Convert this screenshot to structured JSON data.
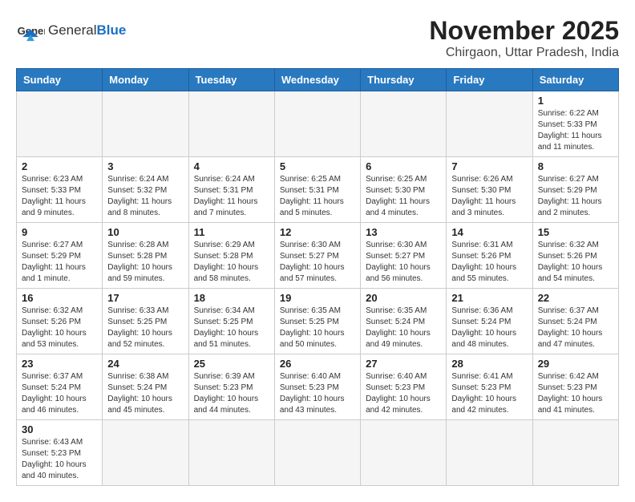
{
  "header": {
    "logo_general": "General",
    "logo_blue": "Blue",
    "month_title": "November 2025",
    "location": "Chirgaon, Uttar Pradesh, India"
  },
  "weekdays": [
    "Sunday",
    "Monday",
    "Tuesday",
    "Wednesday",
    "Thursday",
    "Friday",
    "Saturday"
  ],
  "weeks": [
    [
      {
        "day": "",
        "info": ""
      },
      {
        "day": "",
        "info": ""
      },
      {
        "day": "",
        "info": ""
      },
      {
        "day": "",
        "info": ""
      },
      {
        "day": "",
        "info": ""
      },
      {
        "day": "",
        "info": ""
      },
      {
        "day": "1",
        "info": "Sunrise: 6:22 AM\nSunset: 5:33 PM\nDaylight: 11 hours and 11 minutes."
      }
    ],
    [
      {
        "day": "2",
        "info": "Sunrise: 6:23 AM\nSunset: 5:33 PM\nDaylight: 11 hours and 9 minutes."
      },
      {
        "day": "3",
        "info": "Sunrise: 6:24 AM\nSunset: 5:32 PM\nDaylight: 11 hours and 8 minutes."
      },
      {
        "day": "4",
        "info": "Sunrise: 6:24 AM\nSunset: 5:31 PM\nDaylight: 11 hours and 7 minutes."
      },
      {
        "day": "5",
        "info": "Sunrise: 6:25 AM\nSunset: 5:31 PM\nDaylight: 11 hours and 5 minutes."
      },
      {
        "day": "6",
        "info": "Sunrise: 6:25 AM\nSunset: 5:30 PM\nDaylight: 11 hours and 4 minutes."
      },
      {
        "day": "7",
        "info": "Sunrise: 6:26 AM\nSunset: 5:30 PM\nDaylight: 11 hours and 3 minutes."
      },
      {
        "day": "8",
        "info": "Sunrise: 6:27 AM\nSunset: 5:29 PM\nDaylight: 11 hours and 2 minutes."
      }
    ],
    [
      {
        "day": "9",
        "info": "Sunrise: 6:27 AM\nSunset: 5:29 PM\nDaylight: 11 hours and 1 minute."
      },
      {
        "day": "10",
        "info": "Sunrise: 6:28 AM\nSunset: 5:28 PM\nDaylight: 10 hours and 59 minutes."
      },
      {
        "day": "11",
        "info": "Sunrise: 6:29 AM\nSunset: 5:28 PM\nDaylight: 10 hours and 58 minutes."
      },
      {
        "day": "12",
        "info": "Sunrise: 6:30 AM\nSunset: 5:27 PM\nDaylight: 10 hours and 57 minutes."
      },
      {
        "day": "13",
        "info": "Sunrise: 6:30 AM\nSunset: 5:27 PM\nDaylight: 10 hours and 56 minutes."
      },
      {
        "day": "14",
        "info": "Sunrise: 6:31 AM\nSunset: 5:26 PM\nDaylight: 10 hours and 55 minutes."
      },
      {
        "day": "15",
        "info": "Sunrise: 6:32 AM\nSunset: 5:26 PM\nDaylight: 10 hours and 54 minutes."
      }
    ],
    [
      {
        "day": "16",
        "info": "Sunrise: 6:32 AM\nSunset: 5:26 PM\nDaylight: 10 hours and 53 minutes."
      },
      {
        "day": "17",
        "info": "Sunrise: 6:33 AM\nSunset: 5:25 PM\nDaylight: 10 hours and 52 minutes."
      },
      {
        "day": "18",
        "info": "Sunrise: 6:34 AM\nSunset: 5:25 PM\nDaylight: 10 hours and 51 minutes."
      },
      {
        "day": "19",
        "info": "Sunrise: 6:35 AM\nSunset: 5:25 PM\nDaylight: 10 hours and 50 minutes."
      },
      {
        "day": "20",
        "info": "Sunrise: 6:35 AM\nSunset: 5:24 PM\nDaylight: 10 hours and 49 minutes."
      },
      {
        "day": "21",
        "info": "Sunrise: 6:36 AM\nSunset: 5:24 PM\nDaylight: 10 hours and 48 minutes."
      },
      {
        "day": "22",
        "info": "Sunrise: 6:37 AM\nSunset: 5:24 PM\nDaylight: 10 hours and 47 minutes."
      }
    ],
    [
      {
        "day": "23",
        "info": "Sunrise: 6:37 AM\nSunset: 5:24 PM\nDaylight: 10 hours and 46 minutes."
      },
      {
        "day": "24",
        "info": "Sunrise: 6:38 AM\nSunset: 5:24 PM\nDaylight: 10 hours and 45 minutes."
      },
      {
        "day": "25",
        "info": "Sunrise: 6:39 AM\nSunset: 5:23 PM\nDaylight: 10 hours and 44 minutes."
      },
      {
        "day": "26",
        "info": "Sunrise: 6:40 AM\nSunset: 5:23 PM\nDaylight: 10 hours and 43 minutes."
      },
      {
        "day": "27",
        "info": "Sunrise: 6:40 AM\nSunset: 5:23 PM\nDaylight: 10 hours and 42 minutes."
      },
      {
        "day": "28",
        "info": "Sunrise: 6:41 AM\nSunset: 5:23 PM\nDaylight: 10 hours and 42 minutes."
      },
      {
        "day": "29",
        "info": "Sunrise: 6:42 AM\nSunset: 5:23 PM\nDaylight: 10 hours and 41 minutes."
      }
    ],
    [
      {
        "day": "30",
        "info": "Sunrise: 6:43 AM\nSunset: 5:23 PM\nDaylight: 10 hours and 40 minutes."
      },
      {
        "day": "",
        "info": ""
      },
      {
        "day": "",
        "info": ""
      },
      {
        "day": "",
        "info": ""
      },
      {
        "day": "",
        "info": ""
      },
      {
        "day": "",
        "info": ""
      },
      {
        "day": "",
        "info": ""
      }
    ]
  ]
}
